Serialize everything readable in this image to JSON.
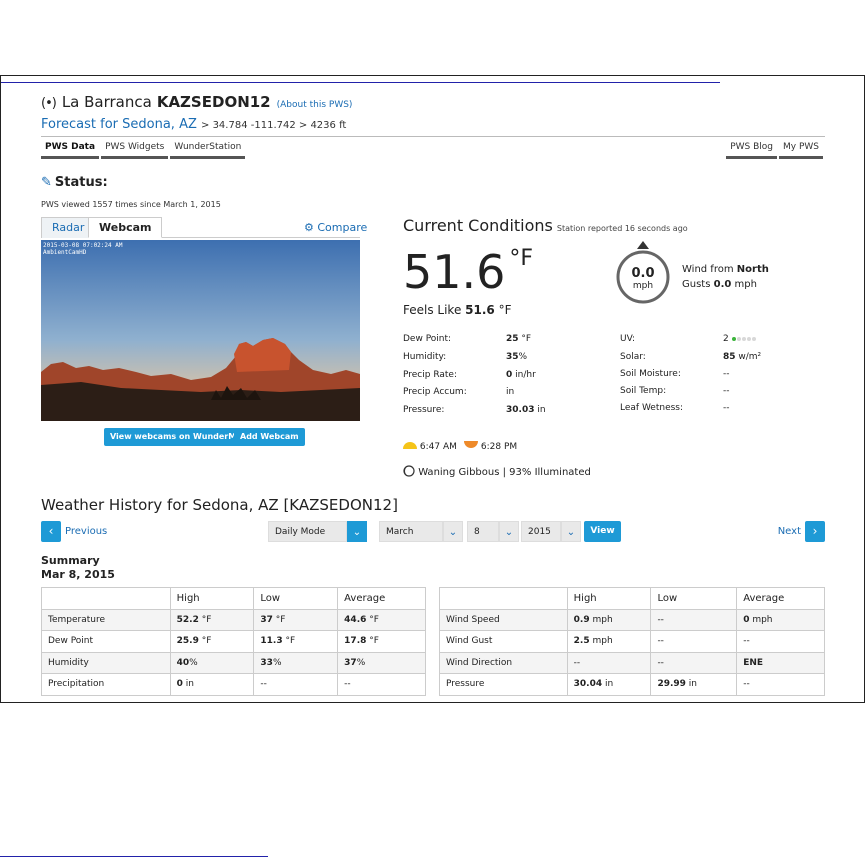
{
  "header": {
    "radio_icon": "(•)",
    "name": "La Barranca",
    "station_id": "KAZSEDON12",
    "about_link": "(About this PWS)",
    "forecast_link": "Forecast for Sedona, AZ",
    "coords": "> 34.784 -111.742 > 4236 ft"
  },
  "tabs_left": [
    "PWS Data",
    "PWS Widgets",
    "WunderStation"
  ],
  "tabs_right": [
    "PWS Blog",
    "My PWS"
  ],
  "status": {
    "label": "Status:",
    "viewed": "PWS viewed 1557 times since March 1, 2015"
  },
  "camera": {
    "tab_radar": "Radar",
    "tab_webcam": "Webcam",
    "compare": "Compare",
    "stamp_line1": "2015-03-08 07:02:24 AM",
    "stamp_line2": "AmbientCamHD",
    "btn_map": "View webcams on WunderMap",
    "btn_add": "Add Webcam"
  },
  "current": {
    "title": "Current Conditions",
    "reported": "Station reported 16 seconds ago",
    "temp": "51.6",
    "temp_unit": "°F",
    "feels_label": "Feels Like",
    "feels_value": "51.6",
    "feels_unit": "°F",
    "wind_speed": "0.0",
    "wind_unit": "mph",
    "wind_from_label": "Wind from",
    "wind_from_value": "North",
    "gusts_label": "Gusts",
    "gusts_value": "0.0",
    "gusts_unit": "mph"
  },
  "metrics_left": [
    {
      "label": "Dew Point:",
      "value": "25",
      "unit": " °F"
    },
    {
      "label": "Humidity:",
      "value": "35",
      "unit": "%"
    },
    {
      "label": "Precip Rate:",
      "value": "0",
      "unit": " in/hr"
    },
    {
      "label": "Precip Accum:",
      "value": "",
      "unit": "in"
    },
    {
      "label": "Pressure:",
      "value": "30.03",
      "unit": " in"
    }
  ],
  "metrics_right": [
    {
      "label": "UV:",
      "value": "2",
      "unit": ""
    },
    {
      "label": "Solar:",
      "value": "85",
      "unit": " w/m²"
    },
    {
      "label": "Soil Moisture:",
      "value": "",
      "unit": "--"
    },
    {
      "label": "Soil Temp:",
      "value": "",
      "unit": "--"
    },
    {
      "label": "Leaf Wetness:",
      "value": "",
      "unit": "--"
    }
  ],
  "uv_level": {
    "value": 2,
    "max": 5
  },
  "sun": {
    "sunrise": "6:47 AM",
    "sunset": "6:28 PM"
  },
  "moon": {
    "phase": "Waning Gibbous",
    "illum": "| 93% Illuminated"
  },
  "history": {
    "title": "Weather History for Sedona, AZ [KAZSEDON12]",
    "prev": "Previous",
    "next": "Next",
    "mode": "Daily Mode",
    "month": "March",
    "day": "8",
    "year": "2015",
    "view": "View",
    "summary_label": "Summary",
    "summary_date": "Mar 8, 2015"
  },
  "table_left": {
    "headers": [
      "",
      "High",
      "Low",
      "Average"
    ],
    "rows": [
      {
        "label": "Temperature",
        "high": "52.2",
        "high_u": " °F",
        "low": "37",
        "low_u": " °F",
        "avg": "44.6",
        "avg_u": " °F"
      },
      {
        "label": "Dew Point",
        "high": "25.9",
        "high_u": " °F",
        "low": "11.3",
        "low_u": " °F",
        "avg": "17.8",
        "avg_u": " °F"
      },
      {
        "label": "Humidity",
        "high": "40",
        "high_u": "%",
        "low": "33",
        "low_u": "%",
        "avg": "37",
        "avg_u": "%"
      },
      {
        "label": "Precipitation",
        "high": "0",
        "high_u": " in",
        "low": "--",
        "low_u": "",
        "avg": "--",
        "avg_u": ""
      }
    ]
  },
  "table_right": {
    "headers": [
      "",
      "High",
      "Low",
      "Average"
    ],
    "rows": [
      {
        "label": "Wind Speed",
        "high": "0.9",
        "high_u": " mph",
        "low": "--",
        "low_u": "",
        "avg": "0",
        "avg_u": " mph"
      },
      {
        "label": "Wind Gust",
        "high": "2.5",
        "high_u": " mph",
        "low": "--",
        "low_u": "",
        "avg": "--",
        "avg_u": ""
      },
      {
        "label": "Wind Direction",
        "high": "--",
        "high_u": "",
        "low": "--",
        "low_u": "",
        "avg": "ENE",
        "avg_u": ""
      },
      {
        "label": "Pressure",
        "high": "30.04",
        "high_u": " in",
        "low": "29.99",
        "low_u": " in",
        "avg": "--",
        "avg_u": ""
      }
    ]
  },
  "colors": {
    "accent": "#1e9ad6",
    "link": "#1a6cb3",
    "sun": "#f5c419",
    "sunset": "#ee8a2a"
  }
}
